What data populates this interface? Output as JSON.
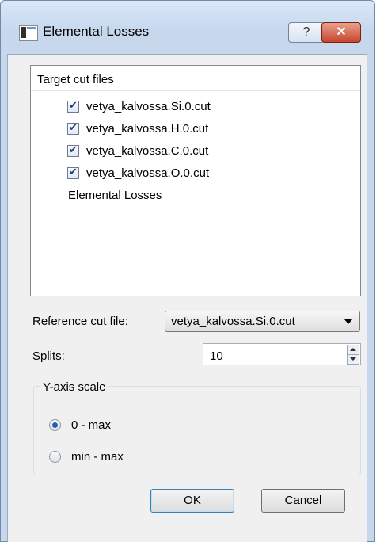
{
  "window": {
    "title": "Elemental Losses",
    "help_label": "?",
    "close_label": "✕"
  },
  "target_list": {
    "header": "Target cut files",
    "items": [
      {
        "label": "vetya_kalvossa.Si.0.cut",
        "checked": true
      },
      {
        "label": "vetya_kalvossa.H.0.cut",
        "checked": true
      },
      {
        "label": "vetya_kalvossa.C.0.cut",
        "checked": true
      },
      {
        "label": "vetya_kalvossa.O.0.cut",
        "checked": true
      }
    ],
    "extra_item": "Elemental Losses"
  },
  "reference": {
    "label": "Reference cut file:",
    "value": "vetya_kalvossa.Si.0.cut"
  },
  "splits": {
    "label": "Splits:",
    "value": "10"
  },
  "y_axis_scale": {
    "title": "Y-axis scale",
    "options": [
      {
        "label": "0 - max",
        "selected": true
      },
      {
        "label": "min - max",
        "selected": false
      }
    ]
  },
  "buttons": {
    "ok": "OK",
    "cancel": "Cancel"
  }
}
